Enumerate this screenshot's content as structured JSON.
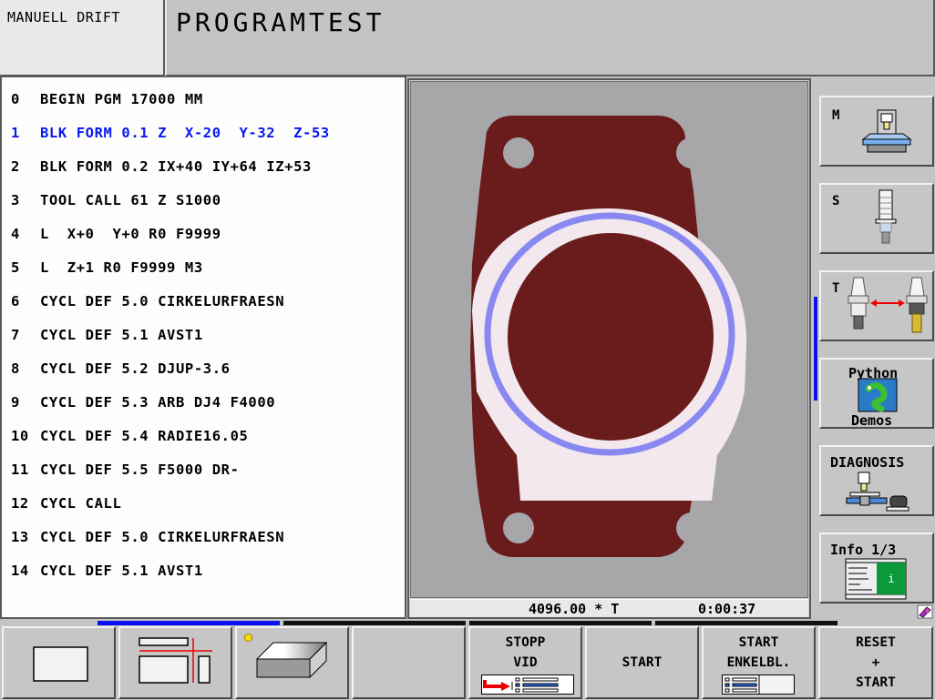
{
  "header": {
    "mode": "MANUELL DRIFT",
    "title": "PROGRAMTEST"
  },
  "program": {
    "lines": [
      {
        "n": "0",
        "text": "BEGIN PGM 17000 MM",
        "active": false
      },
      {
        "n": "1",
        "text": "BLK FORM 0.1 Z  X-20  Y-32  Z-53",
        "active": true
      },
      {
        "n": "2",
        "text": "BLK FORM 0.2 IX+40 IY+64 IZ+53",
        "active": false
      },
      {
        "n": "3",
        "text": "TOOL CALL 61 Z S1000",
        "active": false
      },
      {
        "n": "4",
        "text": "L  X+0  Y+0 R0 F9999",
        "active": false
      },
      {
        "n": "5",
        "text": "L  Z+1 R0 F9999 M3",
        "active": false
      },
      {
        "n": "6",
        "text": "CYCL DEF 5.0 CIRKELURFRAESN",
        "active": false
      },
      {
        "n": "7",
        "text": "CYCL DEF 5.1 AVST1",
        "active": false
      },
      {
        "n": "8",
        "text": "CYCL DEF 5.2 DJUP-3.6",
        "active": false
      },
      {
        "n": "9",
        "text": "CYCL DEF 5.3 ARB DJ4 F4000",
        "active": false
      },
      {
        "n": "10",
        "text": "CYCL DEF 5.4 RADIE16.05",
        "active": false
      },
      {
        "n": "11",
        "text": "CYCL DEF 5.5 F5000 DR-",
        "active": false
      },
      {
        "n": "12",
        "text": "CYCL CALL",
        "active": false
      },
      {
        "n": "13",
        "text": "CYCL DEF 5.0 CIRKELURFRAESN",
        "active": false
      },
      {
        "n": "14",
        "text": "CYCL DEF 5.1 AVST1",
        "active": false
      }
    ]
  },
  "graphic": {
    "status_feed": "4096.00 * T",
    "status_time": "0:00:37",
    "colors": {
      "background": "#a7a7aa",
      "part": "#6a1c1c",
      "machined": "#f2e8ee",
      "path": "#8888f0"
    }
  },
  "side_softkeys": [
    {
      "id": "M",
      "label": "M",
      "icon": "machine-table-icon"
    },
    {
      "id": "S",
      "label": "S",
      "icon": "spindle-icon"
    },
    {
      "id": "T",
      "label": "T",
      "icon": "tool-change-icon"
    },
    {
      "id": "python",
      "label_top": "Python",
      "label_bottom": "Demos",
      "icon": "python-snake-icon"
    },
    {
      "id": "diagnosis",
      "label": "DIAGNOSIS",
      "icon": "diagnosis-machine-icon"
    },
    {
      "id": "info",
      "label": "Info 1/3",
      "icon": "info-window-icon"
    }
  ],
  "bottom_softkeys": [
    {
      "id": "view-plan",
      "icon": "single-view-icon"
    },
    {
      "id": "view-3plane",
      "icon": "three-plane-view-icon"
    },
    {
      "id": "view-3d",
      "icon": "3d-block-icon"
    },
    {
      "id": "empty",
      "icon": ""
    },
    {
      "id": "stopp-vid",
      "line1": "STOPP",
      "line2": "VID",
      "icon": "stop-at-block-icon"
    },
    {
      "id": "start",
      "line1": "START"
    },
    {
      "id": "start-enkelbl",
      "line1": "START",
      "line2": "ENKELBL.",
      "icon": "single-block-icon"
    },
    {
      "id": "reset-start",
      "line1": "RESET",
      "line2": "+",
      "line3": "START"
    }
  ],
  "colors": {
    "active_line": "#0a18f0",
    "indicator": "#1010ee",
    "info_green": "#0a9a3a",
    "led_yellow": "#f8e000"
  }
}
